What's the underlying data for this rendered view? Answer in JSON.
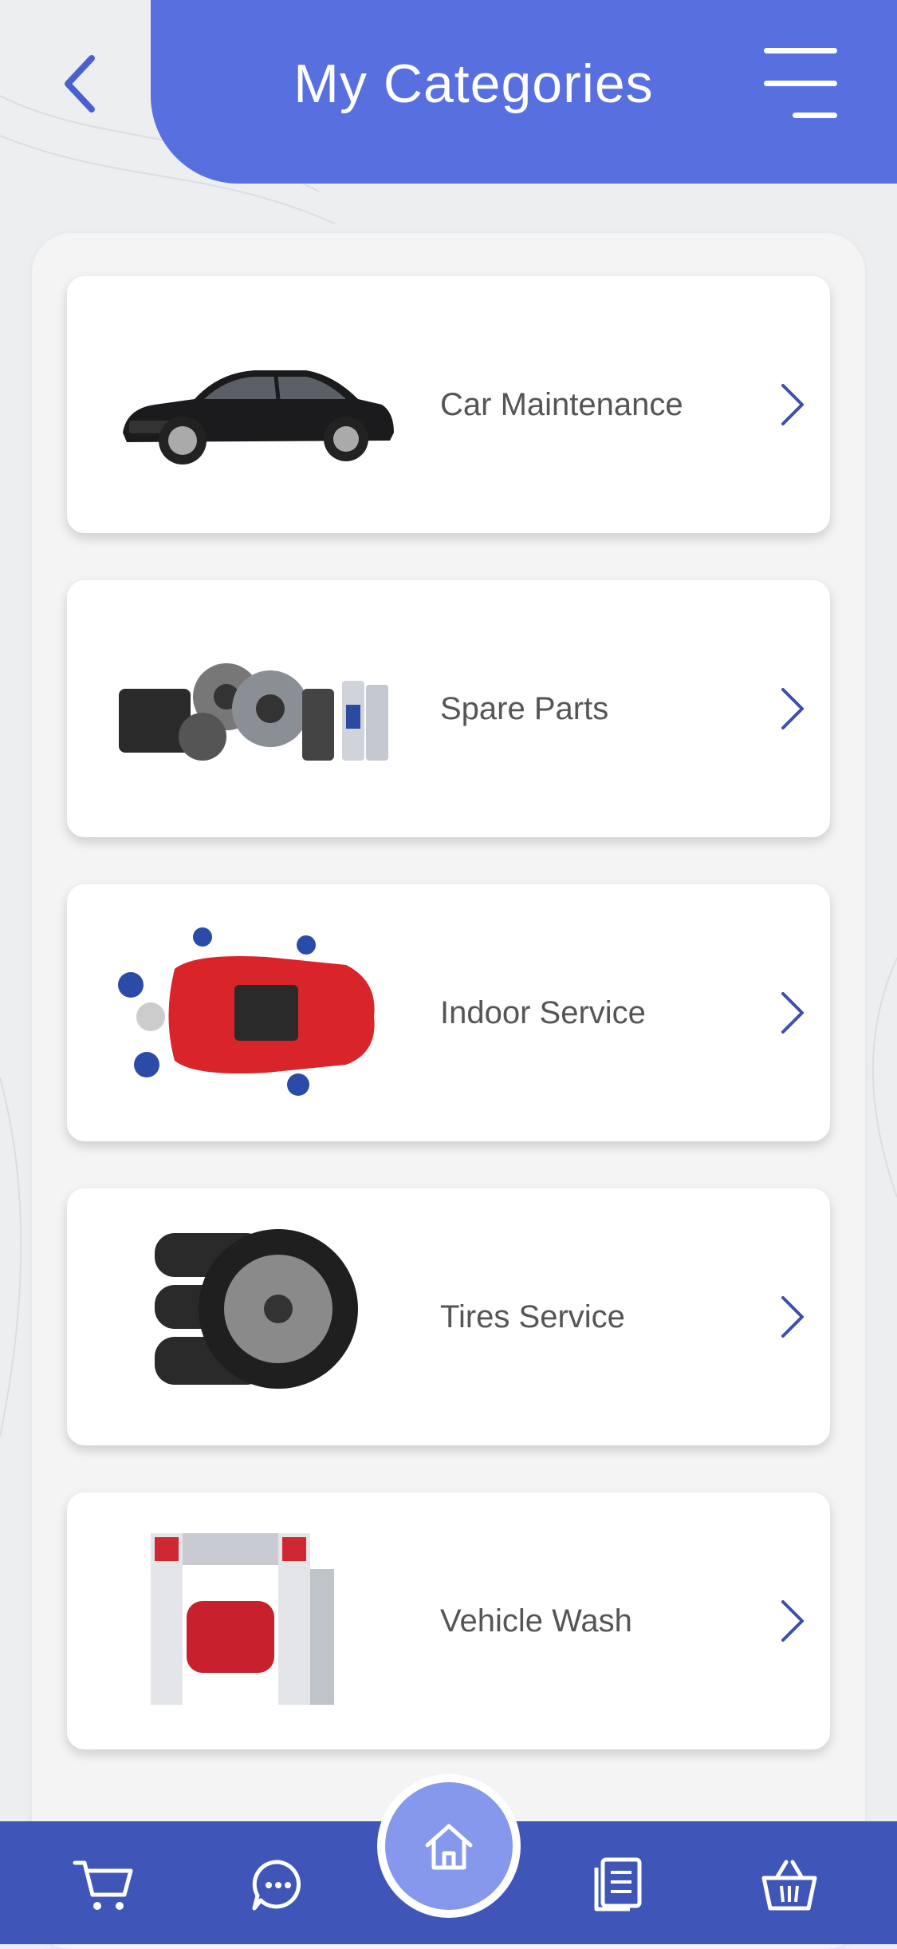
{
  "header": {
    "title": "My Categories"
  },
  "categories": [
    {
      "label": "Car Maintenance",
      "image": "sedan-car-image"
    },
    {
      "label": "Spare Parts",
      "image": "auto-parts-image"
    },
    {
      "label": "Indoor Service",
      "image": "mechanics-red-car-image"
    },
    {
      "label": "Tires Service",
      "image": "tire-stack-image"
    },
    {
      "label": "Vehicle Wash",
      "image": "car-wash-machine-image"
    }
  ],
  "bottom_nav": [
    "cart-icon",
    "chat-icon",
    "home-icon",
    "documents-icon",
    "basket-icon"
  ],
  "colors": {
    "accent": "#586fe0",
    "bottom_bar": "#3f56b8",
    "home_button": "#8598ec",
    "chevron": "#3d4fa8"
  }
}
